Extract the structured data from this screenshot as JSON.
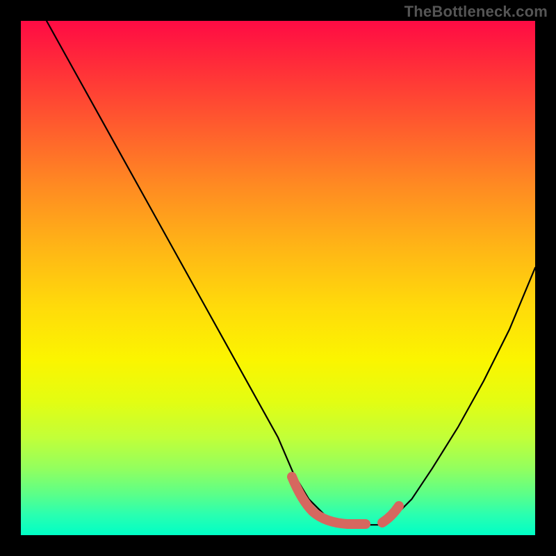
{
  "watermark": "TheBottleneck.com",
  "colors": {
    "background": "#000000",
    "curve": "#000000",
    "marker": "#d6675f",
    "gradient_top": "#ff0b44",
    "gradient_bottom": "#00ffc6"
  },
  "chart_data": {
    "type": "line",
    "title": "",
    "xlabel": "",
    "ylabel": "",
    "xlim": [
      0,
      100
    ],
    "ylim": [
      0,
      100
    ],
    "grid": false,
    "legend": false,
    "annotations": [],
    "series": [
      {
        "name": "curve",
        "x": [
          5,
          10,
          15,
          20,
          25,
          30,
          35,
          40,
          45,
          50,
          53,
          56,
          60,
          64,
          68,
          70,
          72,
          76,
          80,
          85,
          90,
          95,
          100
        ],
        "y": [
          100,
          91,
          82,
          73,
          64,
          55,
          46,
          37,
          28,
          19,
          12,
          7,
          3,
          2,
          2,
          2,
          3,
          7,
          13,
          21,
          30,
          40,
          52
        ]
      }
    ],
    "markers": [
      {
        "name": "pink-valley-left",
        "x_range": [
          53,
          65
        ],
        "y": 3
      },
      {
        "name": "pink-valley-right",
        "x_range": [
          69,
          73
        ],
        "y": 4
      }
    ]
  }
}
